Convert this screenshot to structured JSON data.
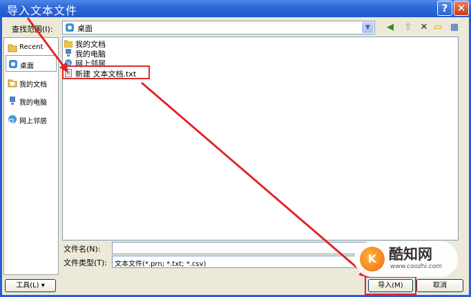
{
  "window": {
    "title": "导入文本文件",
    "help_label": "?",
    "close_label": "✕"
  },
  "lookin": {
    "label": "查找范围(I):",
    "value": "桌面",
    "arrow": "▼"
  },
  "toolbar": {
    "back": "◀",
    "up": "⇧",
    "delete": "✕",
    "new_folder": "▭",
    "views": "▦"
  },
  "places": [
    {
      "label": "Recent",
      "icon": "recent-folder-icon"
    },
    {
      "label": "桌面",
      "icon": "desktop-icon"
    },
    {
      "label": "我的文档",
      "icon": "my-documents-icon"
    },
    {
      "label": "我的电脑",
      "icon": "my-computer-icon"
    },
    {
      "label": "网上邻居",
      "icon": "network-places-icon"
    }
  ],
  "files": [
    {
      "label": "我的文档",
      "icon": "folder-icon"
    },
    {
      "label": "我的电脑",
      "icon": "computer-icon"
    },
    {
      "label": "网上邻居",
      "icon": "network-icon"
    },
    {
      "label": "新建 文本文档.txt",
      "icon": "text-file-icon"
    }
  ],
  "filename": {
    "label": "文件名(N):",
    "value": ""
  },
  "filetype": {
    "label": "文件类型(T):",
    "value": "文本文件(*.prn; *.txt; *.csv)"
  },
  "buttons": {
    "tools": "工具(L) ▾",
    "import": "导入(M)",
    "cancel": "取消"
  },
  "watermark": {
    "logo": "K",
    "brand": "酷知网",
    "url": "www.coozhi.com"
  },
  "colors": {
    "titlebar": "#2f68d8",
    "dialog_bg": "#ece9d8",
    "annotation_red": "#e0262a"
  }
}
